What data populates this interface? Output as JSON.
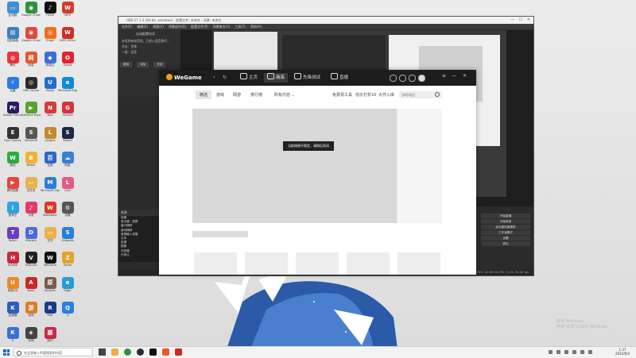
{
  "desktop_icons": [
    {
      "name": "此电脑",
      "color": "#3d8fd8",
      "g": "▭"
    },
    {
      "name": "Google Chrome",
      "color": "#2f8f3f",
      "g": "◉"
    },
    {
      "name": "TikTok",
      "color": "#111111",
      "g": "♪"
    },
    {
      "name": "WPS",
      "color": "#d33b2f",
      "g": "W"
    },
    {
      "name": "控制面板",
      "color": "#3d7fbf",
      "g": "▤"
    },
    {
      "name": "Google Chrome",
      "color": "#e04a3a",
      "g": "◉"
    },
    {
      "name": "Origin",
      "color": "#f26c1f",
      "g": "◎"
    },
    {
      "name": "WPS Office",
      "color": "#c9302c",
      "g": "W"
    },
    {
      "name": "腾讯",
      "color": "#e8343e",
      "g": "◍"
    },
    {
      "name": "网易",
      "color": "#e4572e",
      "g": "网"
    },
    {
      "name": "网易云",
      "color": "#3b6fd8",
      "g": "◆"
    },
    {
      "name": "Opera",
      "color": "#e3222c",
      "g": "O"
    },
    {
      "name": "迅雷",
      "color": "#2a7be4",
      "g": "⚡"
    },
    {
      "name": "OBS Studio",
      "color": "#2a2a2a",
      "g": "◎"
    },
    {
      "name": "Uplay",
      "color": "#1f6fd0",
      "g": "U"
    },
    {
      "name": "Microsoft Edge",
      "color": "#0f8bd6",
      "g": "e"
    },
    {
      "name": "Adobe Premiere",
      "color": "#2a1a5e",
      "g": "Pr"
    },
    {
      "name": "GeForce Experience",
      "color": "#5aa02c",
      "g": "▶"
    },
    {
      "name": "Nox",
      "color": "#d93a3a",
      "g": "N"
    },
    {
      "name": "Garena",
      "color": "#d2343f",
      "g": "G"
    },
    {
      "name": "Epic Games",
      "color": "#333333",
      "g": "E"
    },
    {
      "name": "SteamVR",
      "color": "#555555",
      "g": "S"
    },
    {
      "name": "League",
      "color": "#c28a2b",
      "g": "L"
    },
    {
      "name": "Steam",
      "color": "#1b2a44",
      "g": "S"
    },
    {
      "name": "微信",
      "color": "#2daa3f",
      "g": "W"
    },
    {
      "name": "Bilibili",
      "color": "#f0b434",
      "g": "B"
    },
    {
      "name": "百度",
      "color": "#2a66cc",
      "g": "百"
    },
    {
      "name": "网盘",
      "color": "#3a80d8",
      "g": "☁"
    },
    {
      "name": "腾讯视频",
      "color": "#e9443c",
      "g": "▶"
    },
    {
      "name": "文件夹",
      "color": "#e8b24a",
      "g": "▭"
    },
    {
      "name": "Microsoft Store",
      "color": "#2a7fd8",
      "g": "M"
    },
    {
      "name": "Lala",
      "color": "#e05a8a",
      "g": "L"
    },
    {
      "name": "爱奇艺",
      "color": "#2ea3e4",
      "g": "i"
    },
    {
      "name": "抖音",
      "color": "#e23c6b",
      "g": "♪"
    },
    {
      "name": "Wallpaper",
      "color": "#d83a2a",
      "g": "W"
    },
    {
      "name": "设置",
      "color": "#555555",
      "g": "⚙"
    },
    {
      "name": "Twitch",
      "color": "#6a3fbf",
      "g": "T"
    },
    {
      "name": "Discord",
      "color": "#4a6cd8",
      "g": "D"
    },
    {
      "name": "文件",
      "color": "#e8b24a",
      "g": "▭"
    },
    {
      "name": "Snipaste",
      "color": "#2a7fd8",
      "g": "S"
    },
    {
      "name": "Honkai",
      "color": "#c8283a",
      "g": "H"
    },
    {
      "name": "Valorant",
      "color": "#222222",
      "g": "V"
    },
    {
      "name": "WeGame",
      "color": "#111111",
      "g": "W"
    },
    {
      "name": "Zoom",
      "color": "#e0a42a",
      "g": "Z"
    },
    {
      "name": "网易UU",
      "color": "#e88a2a",
      "g": "U"
    },
    {
      "name": "Apex",
      "color": "#c82a2a",
      "g": "A"
    },
    {
      "name": "Genshin",
      "color": "#7a5a4a",
      "g": "原"
    },
    {
      "name": "Edge",
      "color": "#2a9ad8",
      "g": "e"
    },
    {
      "name": "加速器",
      "color": "#2a5fbf",
      "g": "K"
    },
    {
      "name": "游戏",
      "color": "#e07a2a",
      "g": "游"
    },
    {
      "name": "Riot",
      "color": "#1a3a8a",
      "g": "R"
    },
    {
      "name": "Q",
      "color": "#2a7fd8",
      "g": "Q"
    },
    {
      "name": "K",
      "color": "#3a6fd8",
      "g": "K"
    },
    {
      "name": "手柄",
      "color": "#444444",
      "g": "◈"
    },
    {
      "name": "崩坏",
      "color": "#c82a4a",
      "g": "崩"
    }
  ],
  "obs": {
    "title": "OBS 27.1.3 (64-bit, windows) - 配置文件: 未命名 - 场景: 未命名",
    "menu": [
      "文件(F)",
      "编辑(E)",
      "视图(V)",
      "停靠部件(D)",
      "配置文件(P)",
      "场景集合(S)",
      "工具(T)",
      "帮助(H)"
    ],
    "left_title": "自动配置向导",
    "left_lines": [
      "未找到有效音频，已经以混音替代…",
      "开启：音频",
      "一般：混音"
    ],
    "left_buttons": [
      "撤销",
      "添加",
      "关闭"
    ],
    "sources_header": "来源",
    "sources": [
      "场景",
      "显示器 · 投屏",
      "窗口捕获",
      "游戏捕获",
      "音频输入采集",
      "文本",
      "色源",
      "图像",
      "浏览器",
      "已停止"
    ],
    "controls": [
      "开始直播",
      "开始录制",
      "启动虚拟摄像机",
      "工作室模式",
      "设置",
      "退出"
    ],
    "status": "LIVE: 00:00:00   REC: 00:00:00   CPU: 5.1%, 60.00 fps"
  },
  "wegame": {
    "logo": "WeGame",
    "tabs": [
      {
        "label": "主页",
        "active": false
      },
      {
        "label": "商店",
        "active": true
      },
      {
        "label": "先锋测试",
        "active": false
      },
      {
        "label": "直播",
        "active": false
      }
    ],
    "subnav": [
      "精选",
      "游戏",
      "网游",
      "排行榜",
      "所有内容"
    ],
    "subnav_right": [
      "免费领工具",
      "低价打折10",
      "大作入库"
    ],
    "search_placeholder": "游戏/商品",
    "banner_message": "当前网络不稳定，请稍后再试"
  },
  "taskbar": {
    "search_placeholder": "在这里输入你要搜索的内容",
    "time": "1:37",
    "date": "2022/8/4"
  },
  "watermark": [
    "激活 Windows",
    "转到\"设置\"以激活 Windows。"
  ]
}
